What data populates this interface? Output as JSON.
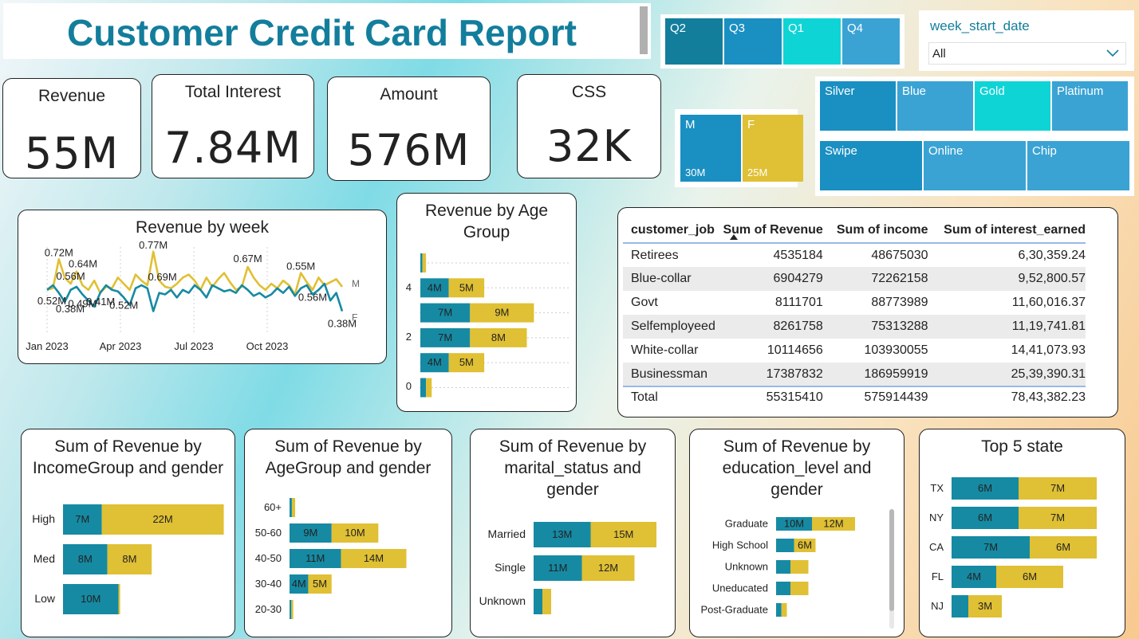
{
  "title": "Customer Credit Card Report",
  "kpis": [
    {
      "label": "Revenue",
      "value": "55M"
    },
    {
      "label": "Total Interest",
      "value": "7.84M"
    },
    {
      "label": "Amount",
      "value": "576M"
    },
    {
      "label": "CSS",
      "value": "32K"
    }
  ],
  "quarter_slicer": {
    "items": [
      "Q2",
      "Q3",
      "Q1",
      "Q4"
    ],
    "colors": [
      "#137e9c",
      "#1a8fc2",
      "#0fd4d6",
      "#3aa3d4"
    ]
  },
  "week_slicer": {
    "label": "week_start_date",
    "value": "All"
  },
  "gender_tiles": [
    {
      "label": "M",
      "value": "30M",
      "color": "#1a8fc2"
    },
    {
      "label": "F",
      "value": "25M",
      "color": "#e0c034"
    }
  ],
  "card_category_tiles": [
    {
      "label": "Silver",
      "color": "#1a8fc2"
    },
    {
      "label": "Blue",
      "color": "#3aa3d4"
    },
    {
      "label": "Gold",
      "color": "#0fd4d6"
    },
    {
      "label": "Platinum",
      "color": "#3aa3d4"
    }
  ],
  "use_chip_tiles": [
    {
      "label": "Swipe",
      "color": "#1a8fc2"
    },
    {
      "label": "Online",
      "color": "#3aa3d4"
    },
    {
      "label": "Chip",
      "color": "#3aa3d4"
    }
  ],
  "table": {
    "headers": [
      "customer_job",
      "Sum of Revenue",
      "Sum of income",
      "Sum of interest_earned"
    ],
    "rows": [
      [
        "Retirees",
        "4535184",
        "48675030",
        "6,30,359.24"
      ],
      [
        "Blue-collar",
        "6904279",
        "72262158",
        "9,52,800.57"
      ],
      [
        "Govt",
        "8111701",
        "88773989",
        "11,60,016.37"
      ],
      [
        "Selfemployeed",
        "8261758",
        "75313288",
        "11,19,741.81"
      ],
      [
        "White-collar",
        "10114656",
        "103930055",
        "14,41,073.93"
      ],
      [
        "Businessman",
        "17387832",
        "186959919",
        "25,39,390.31"
      ]
    ],
    "total": [
      "Total",
      "55315410",
      "575914439",
      "78,43,382.23"
    ]
  },
  "chart_data": [
    {
      "id": "week",
      "type": "line",
      "title": "Revenue by week",
      "x_ticks": [
        "Jan 2023",
        "Apr 2023",
        "Jul 2023",
        "Oct 2023"
      ],
      "ylim": [
        0.3,
        0.8
      ],
      "series": [
        {
          "name": "M",
          "color": "#e0c034",
          "values": [
            0.52,
            0.53,
            0.72,
            0.6,
            0.56,
            0.64,
            0.55,
            0.52,
            0.58,
            0.5,
            0.54,
            0.53,
            0.6,
            0.56,
            0.52,
            0.62,
            0.58,
            0.55,
            0.77,
            0.58,
            0.54,
            0.53,
            0.56,
            0.6,
            0.62,
            0.58,
            0.52,
            0.6,
            0.54,
            0.59,
            0.63,
            0.57,
            0.52,
            0.54,
            0.67,
            0.6,
            0.55,
            0.52,
            0.56,
            0.53,
            0.58,
            0.55,
            0.49,
            0.63,
            0.57,
            0.52,
            0.6,
            0.55,
            0.57,
            0.59,
            0.54
          ]
        },
        {
          "name": "F",
          "color": "#168aa3",
          "values": [
            0.52,
            0.55,
            0.5,
            0.44,
            0.52,
            0.54,
            0.49,
            0.45,
            0.41,
            0.5,
            0.55,
            0.52,
            0.51,
            0.47,
            0.42,
            0.53,
            0.55,
            0.53,
            0.38,
            0.5,
            0.49,
            0.52,
            0.47,
            0.52,
            0.5,
            0.55,
            0.52,
            0.47,
            0.55,
            0.53,
            0.51,
            0.52,
            0.5,
            0.55,
            0.52,
            0.48,
            0.5,
            0.47,
            0.49,
            0.53,
            0.5,
            0.54,
            0.48,
            0.53,
            0.55,
            0.49,
            0.52,
            0.56,
            0.45,
            0.5,
            0.38
          ]
        }
      ],
      "labels": [
        {
          "text": "0.72M",
          "i": 2,
          "s": 0,
          "dx": 0,
          "dy": -4
        },
        {
          "text": "0.56M",
          "i": 4,
          "s": 0,
          "dx": 0,
          "dy": -5
        },
        {
          "text": "0.64M",
          "i": 5,
          "s": 0,
          "dx": 8,
          "dy": -5
        },
        {
          "text": "0.52M",
          "i": 0,
          "s": 1,
          "dx": 6,
          "dy": 18
        },
        {
          "text": "0.49M",
          "i": 6,
          "s": 1,
          "dx": 0,
          "dy": 16
        },
        {
          "text": "0.38M",
          "i": 5,
          "s": 1,
          "dx": -8,
          "dy": 32
        },
        {
          "text": "0.41M",
          "i": 8,
          "s": 1,
          "dx": 8,
          "dy": -2
        },
        {
          "text": "0.77M",
          "i": 18,
          "s": 0,
          "dx": 0,
          "dy": -4
        },
        {
          "text": "0.52M",
          "i": 13,
          "s": 1,
          "dx": 0,
          "dy": 14
        },
        {
          "text": "0.69M",
          "i": 19,
          "s": 0,
          "dx": 4,
          "dy": 0
        },
        {
          "text": "0.67M",
          "i": 34,
          "s": 0,
          "dx": 0,
          "dy": -6
        },
        {
          "text": "0.55M",
          "i": 43,
          "s": 0,
          "dx": 0,
          "dy": -4
        },
        {
          "text": "0.56M",
          "i": 45,
          "s": 1,
          "dx": 0,
          "dy": 8
        },
        {
          "text": "0.38M",
          "i": 50,
          "s": 1,
          "dx": 0,
          "dy": 20
        }
      ]
    },
    {
      "id": "agegroup_small",
      "type": "bar",
      "title": "Revenue by Age Group",
      "y_ticks": [
        "4",
        "2",
        "0"
      ],
      "series": [
        {
          "name": "M",
          "color": "#168aa3",
          "values": [
            0.3,
            4,
            7,
            7,
            4,
            0.8
          ]
        },
        {
          "name": "F",
          "color": "#e0c034",
          "values": [
            0.5,
            5,
            9,
            8,
            5,
            0.8
          ]
        }
      ],
      "labels": [
        [
          "",
          ""
        ],
        [
          "4M",
          "5M"
        ],
        [
          "7M",
          "9M"
        ],
        [
          "7M",
          "8M"
        ],
        [
          "4M",
          "5M"
        ],
        [
          "",
          ""
        ]
      ]
    },
    {
      "id": "income",
      "type": "bar",
      "title": "Sum of Revenue by IncomeGroup and gender",
      "categories": [
        "High",
        "Med",
        "Low"
      ],
      "series": [
        {
          "name": "M",
          "color": "#168aa3",
          "values": [
            7,
            8,
            10
          ]
        },
        {
          "name": "F",
          "color": "#e0c034",
          "values": [
            22,
            8,
            0.3
          ]
        }
      ],
      "labels": [
        [
          "7M",
          "22M"
        ],
        [
          "8M",
          "8M"
        ],
        [
          "10M",
          ""
        ]
      ]
    },
    {
      "id": "agegroup",
      "type": "bar",
      "title": "Sum of Revenue by AgeGroup and gender",
      "categories": [
        "60+",
        "50-60",
        "40-50",
        "30-40",
        "20-30"
      ],
      "series": [
        {
          "name": "M",
          "color": "#168aa3",
          "values": [
            0.5,
            9,
            11,
            4,
            0.4
          ]
        },
        {
          "name": "F",
          "color": "#e0c034",
          "values": [
            0.7,
            10,
            14,
            5,
            0.4
          ]
        }
      ],
      "labels": [
        [
          "",
          ""
        ],
        [
          "9M",
          "10M"
        ],
        [
          "11M",
          "14M"
        ],
        [
          "4M",
          "5M"
        ],
        [
          "",
          ""
        ]
      ]
    },
    {
      "id": "marital",
      "type": "bar",
      "title": "Sum of Revenue by marital_status and gender",
      "categories": [
        "Married",
        "Single",
        "Unknown"
      ],
      "series": [
        {
          "name": "M",
          "color": "#168aa3",
          "values": [
            13,
            11,
            2
          ]
        },
        {
          "name": "F",
          "color": "#e0c034",
          "values": [
            15,
            12,
            2
          ]
        }
      ],
      "labels": [
        [
          "13M",
          "15M"
        ],
        [
          "11M",
          "12M"
        ],
        [
          "",
          ""
        ]
      ]
    },
    {
      "id": "education",
      "type": "bar",
      "title": "Sum of Revenue by education_level and gender",
      "categories": [
        "Graduate",
        "High School",
        "Unknown",
        "Uneducated",
        "Post-Graduate"
      ],
      "series": [
        {
          "name": "M",
          "color": "#168aa3",
          "values": [
            10,
            5,
            4,
            4,
            1.5
          ]
        },
        {
          "name": "F",
          "color": "#e0c034",
          "values": [
            12,
            6,
            5,
            5,
            1.5
          ]
        }
      ],
      "labels": [
        [
          "10M",
          "12M"
        ],
        [
          "",
          "6M"
        ],
        [
          "",
          ""
        ],
        [
          "",
          ""
        ],
        [
          "",
          ""
        ]
      ]
    },
    {
      "id": "state",
      "type": "bar",
      "title": "Top 5 state",
      "categories": [
        "TX",
        "NY",
        "CA",
        "FL",
        "NJ"
      ],
      "series": [
        {
          "name": "M",
          "color": "#168aa3",
          "values": [
            6,
            6,
            7,
            4,
            1.5
          ]
        },
        {
          "name": "F",
          "color": "#e0c034",
          "values": [
            7,
            7,
            6,
            6,
            3
          ]
        }
      ],
      "labels": [
        [
          "6M",
          "7M"
        ],
        [
          "6M",
          "7M"
        ],
        [
          "7M",
          "6M"
        ],
        [
          "4M",
          "6M"
        ],
        [
          "",
          "3M"
        ]
      ]
    }
  ]
}
